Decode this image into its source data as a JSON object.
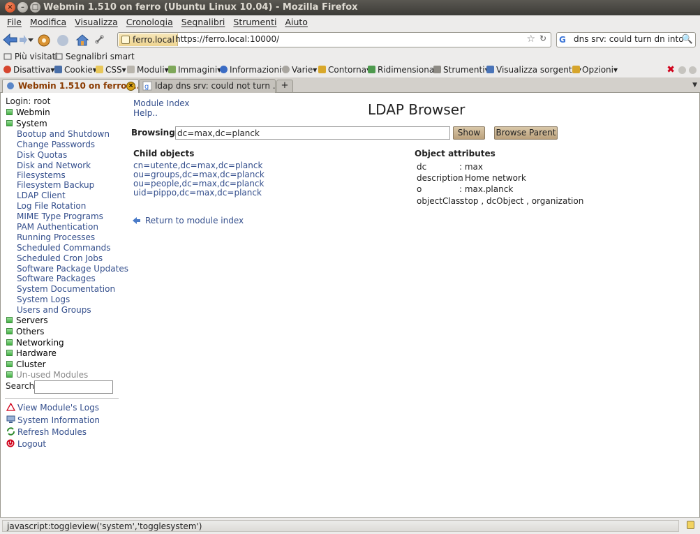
{
  "window": {
    "title": "Webmin 1.510 on ferro (Ubuntu Linux 10.04) - Mozilla Firefox",
    "close_glyph": "×",
    "min_glyph": "–",
    "max_glyph": "□"
  },
  "menubar": [
    "File",
    "Modifica",
    "Visualizza",
    "Cronologia",
    "Segnalibri",
    "Strumenti",
    "Aiuto"
  ],
  "nav": {
    "site_label": "ferro.local",
    "url": "https://ferro.local:10000/",
    "search_value": "dns srv: could turn dn into a dc",
    "star_glyph": "☆",
    "reload_glyph": "↻",
    "magnifier_glyph": "🔍",
    "google_glyph": "G"
  },
  "bookmarks": [
    "Più visitati",
    "Segnalibri smart"
  ],
  "devtoolbar": [
    "Disattiva",
    "Cookie",
    "CSS",
    "Moduli",
    "Immagini",
    "Informazioni",
    "Varie",
    "Contorna",
    "Ridimensiona",
    "Strumenti",
    "Visualizza sorgente",
    "Opzioni"
  ],
  "devtoolbar_close": "✖",
  "tabs": [
    {
      "label": "Webmin 1.510 on ferro (...",
      "active": true
    },
    {
      "label": "ldap dns srv: could not turn ...",
      "active": false
    }
  ],
  "tab_close_glyph": "×",
  "tab_new_glyph": "+",
  "tab_list_glyph": "▼",
  "sidebar": {
    "login": "Login: root",
    "categories_top": [
      "Webmin",
      "System"
    ],
    "system_modules": [
      "Bootup and Shutdown",
      "Change Passwords",
      "Disk Quotas",
      "Disk and Network Filesystems",
      "Filesystem Backup",
      "LDAP Client",
      "Log File Rotation",
      "MIME Type Programs",
      "PAM Authentication",
      "Running Processes",
      "Scheduled Commands",
      "Scheduled Cron Jobs",
      "Software Package Updates",
      "Software Packages",
      "System Documentation",
      "System Logs",
      "Users and Groups"
    ],
    "categories_bottom": [
      "Servers",
      "Others",
      "Networking",
      "Hardware",
      "Cluster",
      "Un-used Modules"
    ],
    "search_label": "Search:",
    "actions": [
      "View Module's Logs",
      "System Information",
      "Refresh Modules",
      "Logout"
    ]
  },
  "main": {
    "module_index": "Module Index",
    "help": "Help..",
    "title": "LDAP Browser",
    "browsing_label": "Browsing:",
    "browsing_value": "dc=max,dc=planck",
    "show_button": "Show",
    "browse_parent_button": "Browse Parent",
    "child_heading": "Child objects",
    "children": [
      "cn=utente,dc=max,dc=planck",
      "ou=groups,dc=max,dc=planck",
      "ou=people,dc=max,dc=planck",
      "uid=pippo,dc=max,dc=planck"
    ],
    "attr_heading": "Object attributes",
    "attributes": [
      {
        "key": "dc",
        "value": ": max"
      },
      {
        "key": "description",
        "value": ": Home network"
      },
      {
        "key": "o",
        "value": ": max.planck"
      },
      {
        "key": "objectClass",
        "value": ": top , dcObject , organization"
      }
    ],
    "return_link": "Return to module index"
  },
  "status": {
    "text": "javascript:toggleview('system','togglesystem')"
  },
  "colors": {
    "link": "#334e8c",
    "active_tab": "#8a3a00",
    "button": "#bba17c"
  }
}
